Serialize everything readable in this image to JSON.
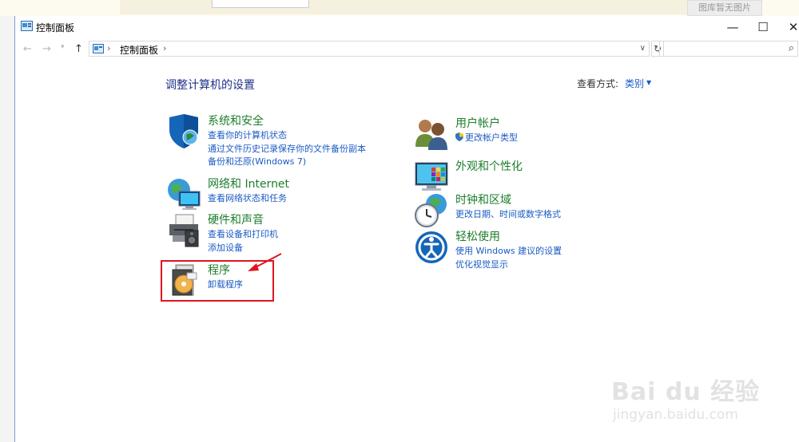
{
  "window": {
    "title": "控制面板",
    "controls": {
      "minimize": "—",
      "maximize": "☐",
      "close": "✕"
    }
  },
  "address": {
    "crumb": "控制面板",
    "separator": "›"
  },
  "content": {
    "heading": "调整计算机的设置",
    "view_by_label": "查看方式:",
    "view_by_value": "类别"
  },
  "categories": [
    {
      "title": "系统和安全",
      "icon": "shield-globe-icon",
      "links": [
        "查看你的计算机状态",
        "通过文件历史记录保存你的文件备份副本",
        "备份和还原(Windows 7)"
      ]
    },
    {
      "title": "网络和 Internet",
      "icon": "network-globe-icon",
      "links": [
        "查看网络状态和任务"
      ]
    },
    {
      "title": "硬件和声音",
      "icon": "printer-speaker-icon",
      "links": [
        "查看设备和打印机",
        "添加设备"
      ]
    },
    {
      "title": "程序",
      "icon": "programs-disc-icon",
      "links": [
        "卸载程序"
      ]
    },
    {
      "title": "用户帐户",
      "icon": "users-icon",
      "links": [
        "更改帐户类型"
      ]
    },
    {
      "title": "外观和个性化",
      "icon": "monitor-palette-icon",
      "links": []
    },
    {
      "title": "时钟和区域",
      "icon": "clock-globe-icon",
      "links": [
        "更改日期、时间或数字格式"
      ]
    },
    {
      "title": "轻松使用",
      "icon": "ease-of-access-icon",
      "links": [
        "使用 Windows 建议的设置",
        "优化视觉显示"
      ]
    }
  ],
  "background": {
    "note": "图库暂无图片"
  },
  "watermark": {
    "logo": "Bai du 经验",
    "url": "jingyan.baidu.com"
  },
  "colors": {
    "category_title": "#1d7d2b",
    "link": "#1a5bc4",
    "heading": "#1e3287",
    "annotation": "#e0141e"
  }
}
